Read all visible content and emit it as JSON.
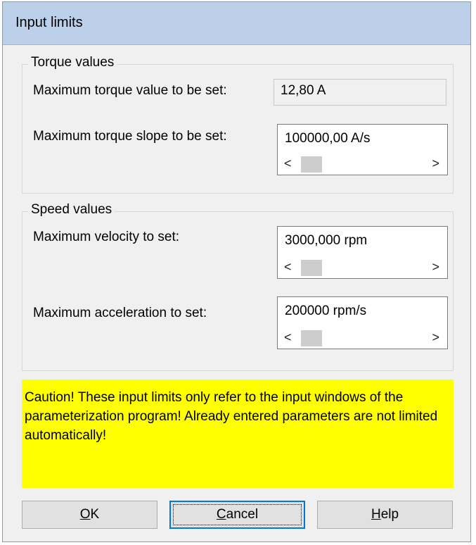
{
  "window": {
    "title": "Input limits"
  },
  "torque": {
    "group_label": "Torque values",
    "max_value_label": "Maximum torque value to be set:",
    "max_value": "12,80  A",
    "max_slope_label": "Maximum torque slope to be set:",
    "max_slope": "100000,00 A/s"
  },
  "speed": {
    "group_label": "Speed values",
    "max_velocity_label": "Maximum velocity to set:",
    "max_velocity": "3000,000 rpm",
    "max_accel_label": "Maximum acceleration to set:",
    "max_accel": "200000 rpm/s"
  },
  "scrollbar": {
    "left_arrow": "<",
    "right_arrow": ">"
  },
  "caution": {
    "text": "Caution! These input limits only refer to the input windows of the parameterization program! Already entered parameters are not limited automatically!",
    "color": "#ffff00"
  },
  "buttons": {
    "ok_mnemonic": "O",
    "ok_rest": "K",
    "cancel_mnemonic": "C",
    "cancel_rest": "ancel",
    "help_mnemonic": "H",
    "help_rest": "elp"
  }
}
